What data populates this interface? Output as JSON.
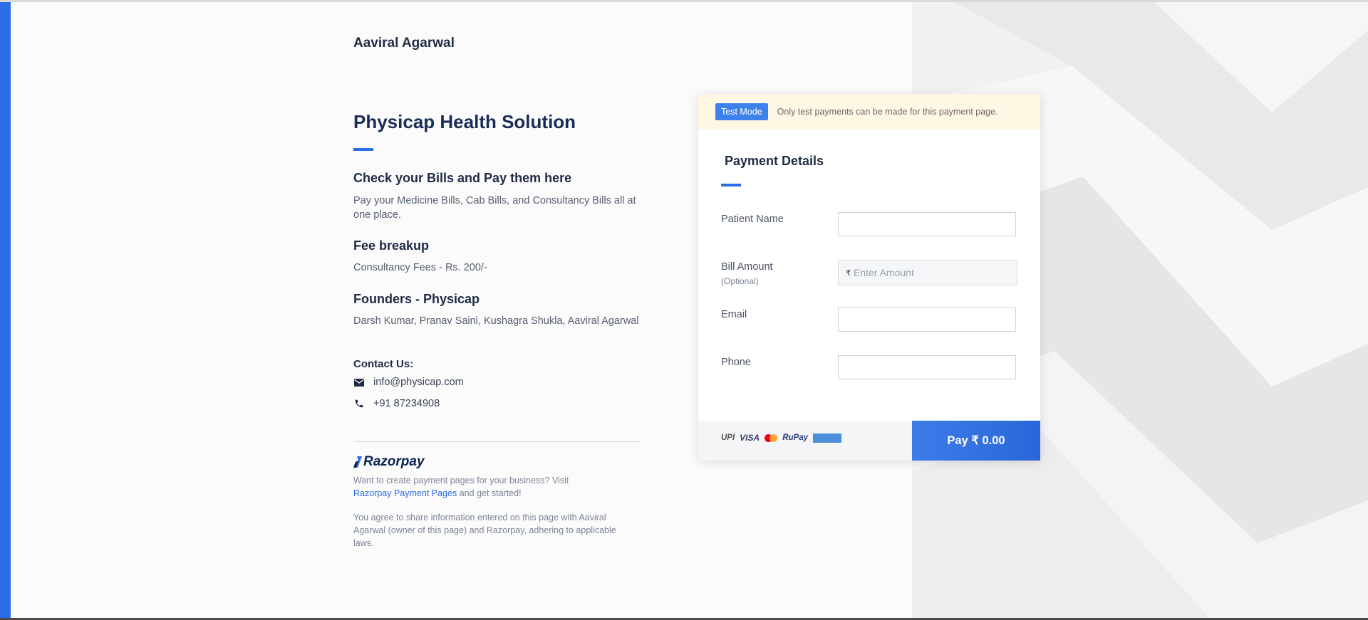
{
  "owner": {
    "name": "Aaviral Agarwal"
  },
  "page": {
    "title": "Physicap Health Solution",
    "sections": [
      {
        "heading": "Check your Bills and Pay them here",
        "text": "Pay your Medicine Bills,  Cab Bills, and Consultancy Bills all at one place."
      },
      {
        "heading": "Fee breakup",
        "text": "Consultancy Fees - Rs. 200/-"
      },
      {
        "heading": "Founders - Physicap",
        "text": "Darsh Kumar, Pranav Saini, Kushagra Shukla, Aaviral Agarwal"
      }
    ]
  },
  "contact": {
    "heading": "Contact Us:",
    "email": "info@physicap.com",
    "phone": "+91 87234908",
    "email_icon": "mail-icon",
    "phone_icon": "phone-icon"
  },
  "razorpay": {
    "logo_text": "Razorpay",
    "promo_prefix": "Want to create payment pages for your business? Visit",
    "promo_link": "Razorpay Payment Pages",
    "promo_suffix": "and get started!",
    "agreement": "You agree to share information entered on this page with Aaviral Agarwal (owner of this page) and Razorpay, adhering to applicable laws."
  },
  "payment_card": {
    "test_badge": "Test Mode",
    "test_message": "Only test payments can be made for this payment page.",
    "title": "Payment Details",
    "fields": {
      "patient_name": {
        "label": "Patient Name",
        "value": ""
      },
      "bill_amount": {
        "label": "Bill Amount",
        "sublabel": "(Optional)",
        "currency": "₹",
        "placeholder": "Enter Amount"
      },
      "email": {
        "label": "Email",
        "value": ""
      },
      "phone": {
        "label": "Phone",
        "value": ""
      }
    },
    "payment_logos": {
      "upi": "UPI",
      "visa": "VISA",
      "rupay": "RuPay"
    },
    "pay_button": "Pay  ₹ 0.00"
  },
  "colors": {
    "accent": "#2d6ee6",
    "heading": "#1f2a44",
    "test_banner_bg": "#fdf7e3",
    "pay_button": "#3c7ce8"
  }
}
